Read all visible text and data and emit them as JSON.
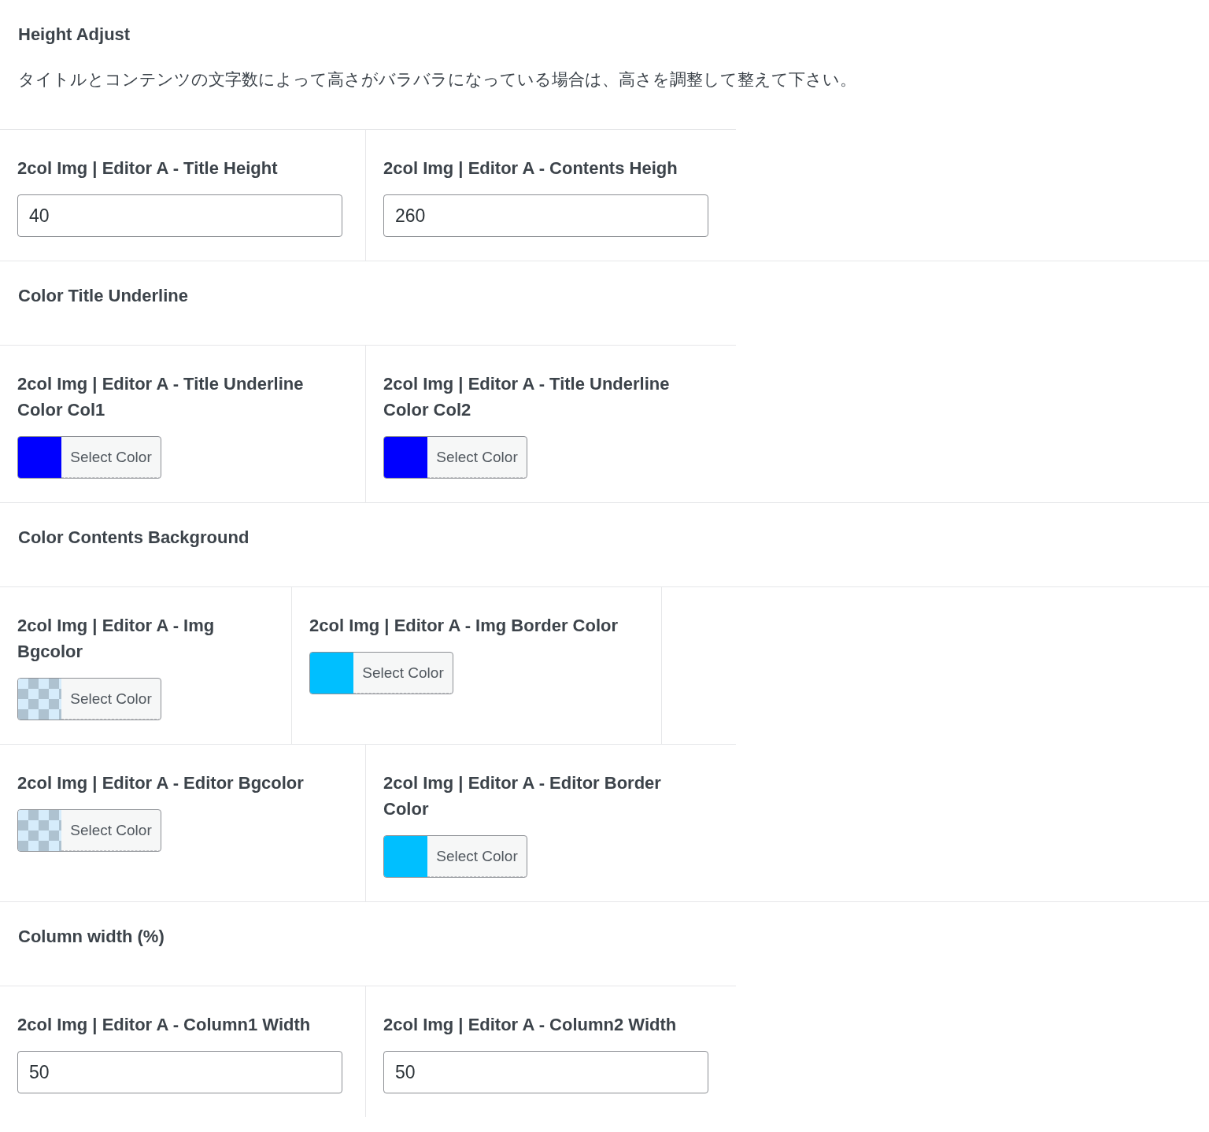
{
  "sections": [
    {
      "kind": "heading",
      "title": "Height Adjust",
      "description": "タイトルとコンテンツの文字数によって高さがバラバラになっている場合は、高さを調整して整えて下さい。"
    },
    {
      "kind": "two_col",
      "fields": [
        {
          "kind": "number",
          "label": "2col Img | Editor A - Title Height",
          "value": "40"
        },
        {
          "kind": "number",
          "label": "2col Img | Editor A - Contents Heigh",
          "value": "260"
        }
      ]
    },
    {
      "kind": "heading",
      "title": "Color Title Underline"
    },
    {
      "kind": "two_col",
      "fields": [
        {
          "kind": "color",
          "label": "2col Img | Editor A - Title Underline Color Col1",
          "button": "Select Color",
          "color": "#0000ff"
        },
        {
          "kind": "color",
          "label": "2col Img | Editor A - Title Underline Color Col2",
          "button": "Select Color",
          "color": "#0000ff"
        }
      ]
    },
    {
      "kind": "heading",
      "title": "Color Contents Background"
    },
    {
      "kind": "three_col",
      "fields": [
        {
          "kind": "color",
          "label": "2col Img | Editor A - Img Bgcolor",
          "button": "Select Color"
        },
        {
          "kind": "color",
          "label": "2col Img | Editor A - Img Border Color",
          "button": "Select Color",
          "color": "#00bfff"
        }
      ]
    },
    {
      "kind": "two_col",
      "fields": [
        {
          "kind": "color",
          "label": "2col Img | Editor A - Editor Bgcolor",
          "button": "Select Color"
        },
        {
          "kind": "color",
          "label": "2col Img | Editor A - Editor Border Color",
          "button": "Select Color",
          "color": "#00bfff"
        }
      ]
    },
    {
      "kind": "heading",
      "title": "Column width (%)"
    },
    {
      "kind": "two_col",
      "fields": [
        {
          "kind": "number",
          "label": "2col Img | Editor A - Column1 Width",
          "value": "50"
        },
        {
          "kind": "number",
          "label": "2col Img | Editor A - Column2 Width",
          "value": "50"
        }
      ]
    }
  ]
}
